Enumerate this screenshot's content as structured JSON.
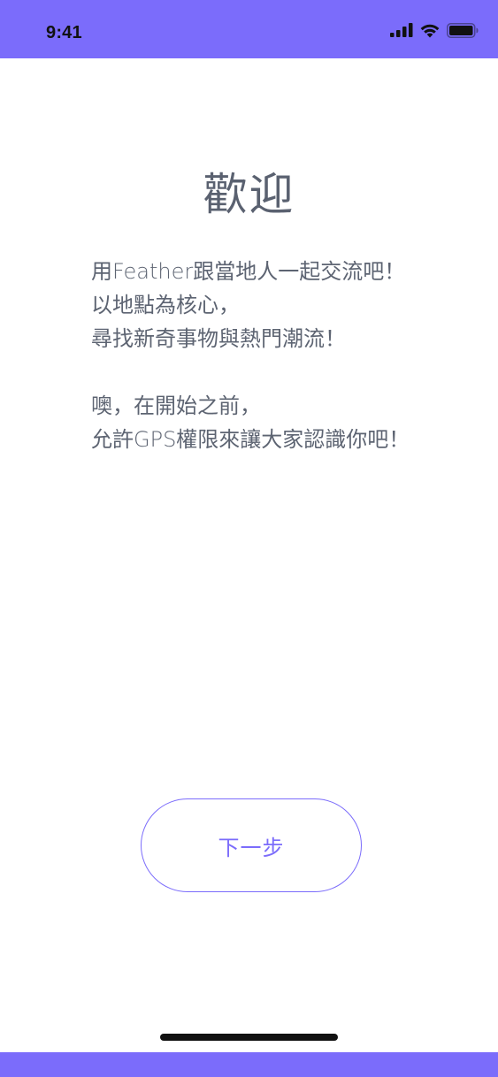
{
  "status_bar": {
    "time": "9:41",
    "icons": [
      "cellular-signal-icon",
      "wifi-icon",
      "battery-icon"
    ]
  },
  "welcome": {
    "title": "歡迎",
    "lines": [
      "用Feather跟當地人一起交流吧！",
      "以地點為核心，",
      "尋找新奇事物與熱門潮流！",
      "噢，在開始之前，",
      "允許GPS權限來讓大家認識你吧！"
    ]
  },
  "actions": {
    "next_label": "下一步"
  },
  "colors": {
    "accent": "#7b6cfb",
    "text": "#5d6472",
    "background": "#ffffff"
  }
}
